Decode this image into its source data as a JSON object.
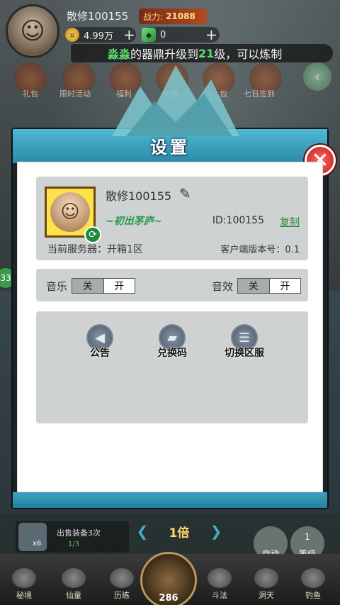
{
  "hud": {
    "player_name": "散修100155",
    "power_label": "战力:",
    "power_value": "21088",
    "coins": "4.99万",
    "jade": "0",
    "plus": "+",
    "marquee_prefix": "淼淼",
    "marquee_mid": "的器鼎升级到",
    "marquee_level": "21",
    "marquee_suffix": "级，可以炼制",
    "top_icons": [
      "礼包",
      "限时活动",
      "福利",
      "仙商",
      "包",
      "七日签到"
    ]
  },
  "dialog": {
    "title": "设置",
    "close_glyph": "✕",
    "profile": {
      "name": "散修100155",
      "realm": "~初出茅庐~",
      "id_label": "ID:100155",
      "copy_label": "复制",
      "server_label": "当前服务器：开箱1区",
      "version_label": "客户端版本号：0.1"
    },
    "audio": {
      "music_label": "音乐",
      "effects_label": "音效",
      "off": "关",
      "on": "开"
    },
    "actions": {
      "notice": "公告",
      "redeem": "兑换码",
      "switch_server": "切换区服"
    }
  },
  "bottom": {
    "sell_label": "出售装备3次",
    "sell_progress": "1/3",
    "sell_count": "x6",
    "multiplier": "1倍",
    "auto_label": "自动",
    "level_label": "等级",
    "level_number": "1",
    "center_level": "286",
    "left_badge": "33",
    "nav": [
      "秘境",
      "仙童",
      "历练",
      "斗法",
      "洞天",
      "钓鱼"
    ]
  },
  "colors": {
    "accent_teal": "#2a8aa8",
    "close_red": "#c11d1d",
    "copy_green": "#2a8a3a",
    "realm_green": "#2a9b4a",
    "marquee_highlight": "#5fe070"
  }
}
